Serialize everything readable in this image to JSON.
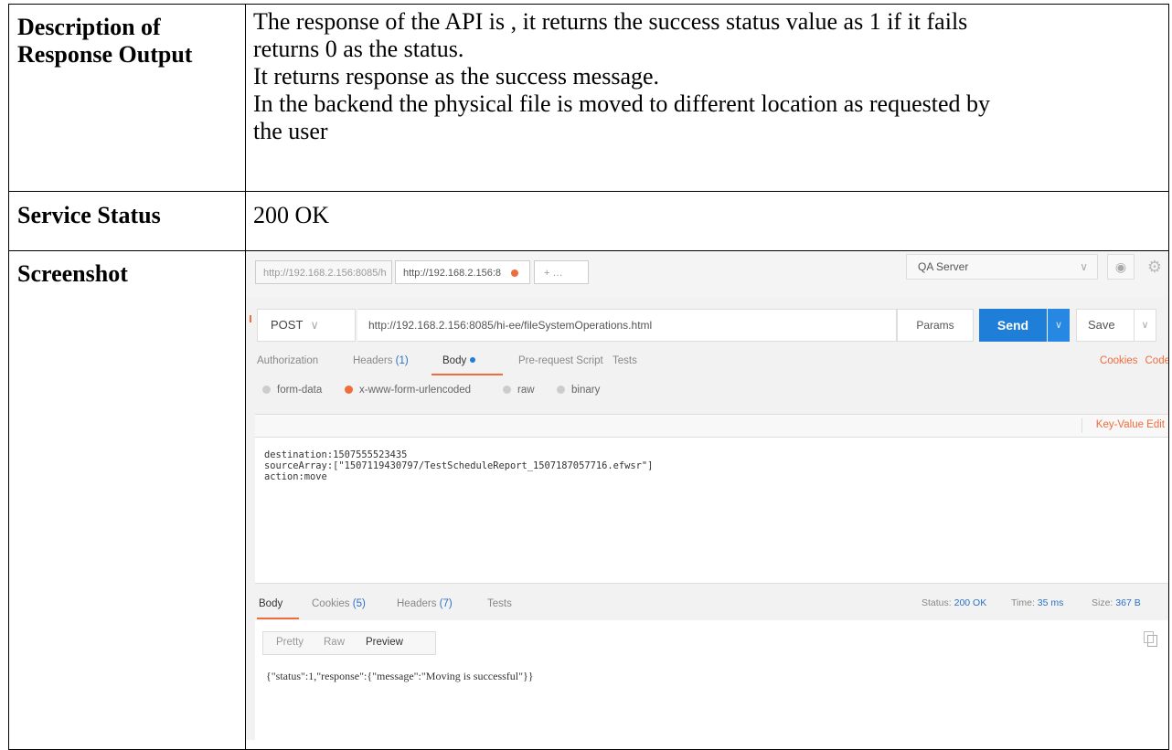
{
  "doc": {
    "rows": [
      {
        "label_lines": [
          "Description of",
          "Response Output"
        ],
        "value_lines": [
          "The response of the API is , it returns the success status value as 1 if it fails",
          "returns 0 as the status.",
          "It returns response as the success message.",
          "In the backend the physical file is moved to different location as requested by",
          "the user"
        ]
      },
      {
        "label": "Service Status",
        "value": "200 OK"
      },
      {
        "label": "Screenshot"
      }
    ]
  },
  "postman": {
    "tabs": [
      "http://192.168.2.156:8085/h",
      "http://192.168.2.156:8",
      "+ …"
    ],
    "environment": "QA Server",
    "method": "POST",
    "url": "http://192.168.2.156:8085/hi-ee/fileSystemOperations.html",
    "params_label": "Params",
    "send_label": "Send",
    "save_label": "Save",
    "request_tabs": {
      "authorization": "Authorization",
      "headers": "Headers",
      "headers_count": "(1)",
      "body": "Body",
      "prerequest": "Pre-request Script",
      "tests": "Tests",
      "cookies": "Cookies",
      "code": "Code"
    },
    "body_modes": [
      "form-data",
      "x-www-form-urlencoded",
      "raw",
      "binary"
    ],
    "key_value_edit": "Key-Value Edit",
    "body_lines": [
      "destination:1507555523435",
      "sourceArray:[\"1507119430797/TestScheduleReport_1507187057716.efwsr\"]",
      "action:move"
    ],
    "response_tabs": {
      "body": "Body",
      "cookies": "Cookies",
      "cookies_count": "(5)",
      "headers": "Headers",
      "headers_count": "(7)",
      "tests": "Tests"
    },
    "status_label": "Status:",
    "status_value": "200 OK",
    "time_label": "Time:",
    "time_value": "35 ms",
    "size_label": "Size:",
    "size_value": "367 B",
    "format_buttons": [
      "Pretty",
      "Raw",
      "Preview"
    ],
    "response_json": "{\"status\":1,\"response\":{\"message\":\"Moving is successful\"}}",
    "colors": {
      "accent": "#f06c3b",
      "send": "#1f7fd8",
      "link": "#2a72c4"
    }
  }
}
